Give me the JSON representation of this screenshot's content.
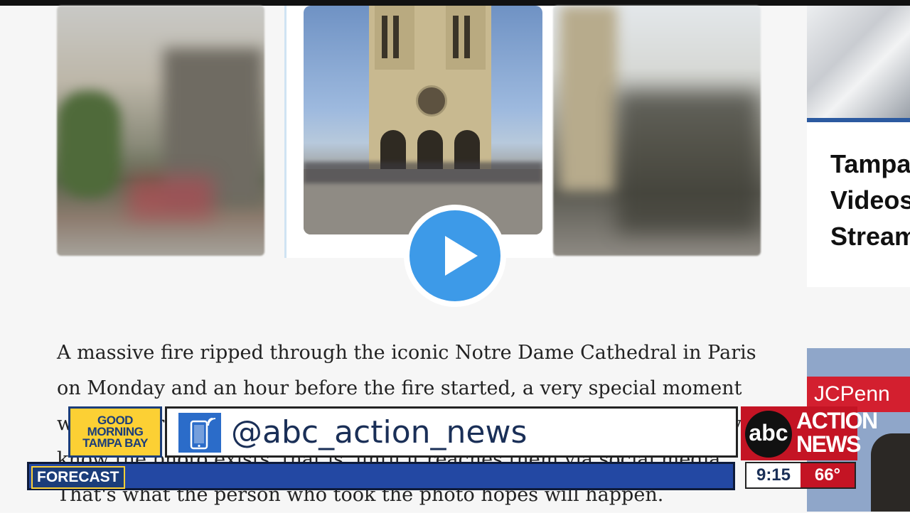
{
  "article": {
    "body_text": "A massive fire ripped through the iconic Notre Dame Cathedral in Paris on Monday and an hour before the fire started, a very special moment was captured. Sometimes, when a photo is taken the subjects don't even know the photo exists, that is, until it reaches them via social media. That's what the person who took the photo hopes will happen."
  },
  "sidebar": {
    "title": "Tampa\nVideos\nStream"
  },
  "ad": {
    "brand": "JCPenn"
  },
  "lower_third": {
    "show_name": [
      "GOOD",
      "MORNING",
      "TAMPA BAY"
    ],
    "social_handle": "@abc_action_news",
    "network_logo": "abc",
    "station_name": "ACTION NEWS",
    "ticker_label": "FORECAST",
    "time": "9:15",
    "temperature": "66°"
  },
  "icons": {
    "play": "play-icon",
    "phone": "phone-icon"
  },
  "colors": {
    "play_blue": "#3d9ae8",
    "abc_red": "#c41424",
    "gm_yellow": "#fcd034",
    "navy": "#1b3d7a"
  }
}
